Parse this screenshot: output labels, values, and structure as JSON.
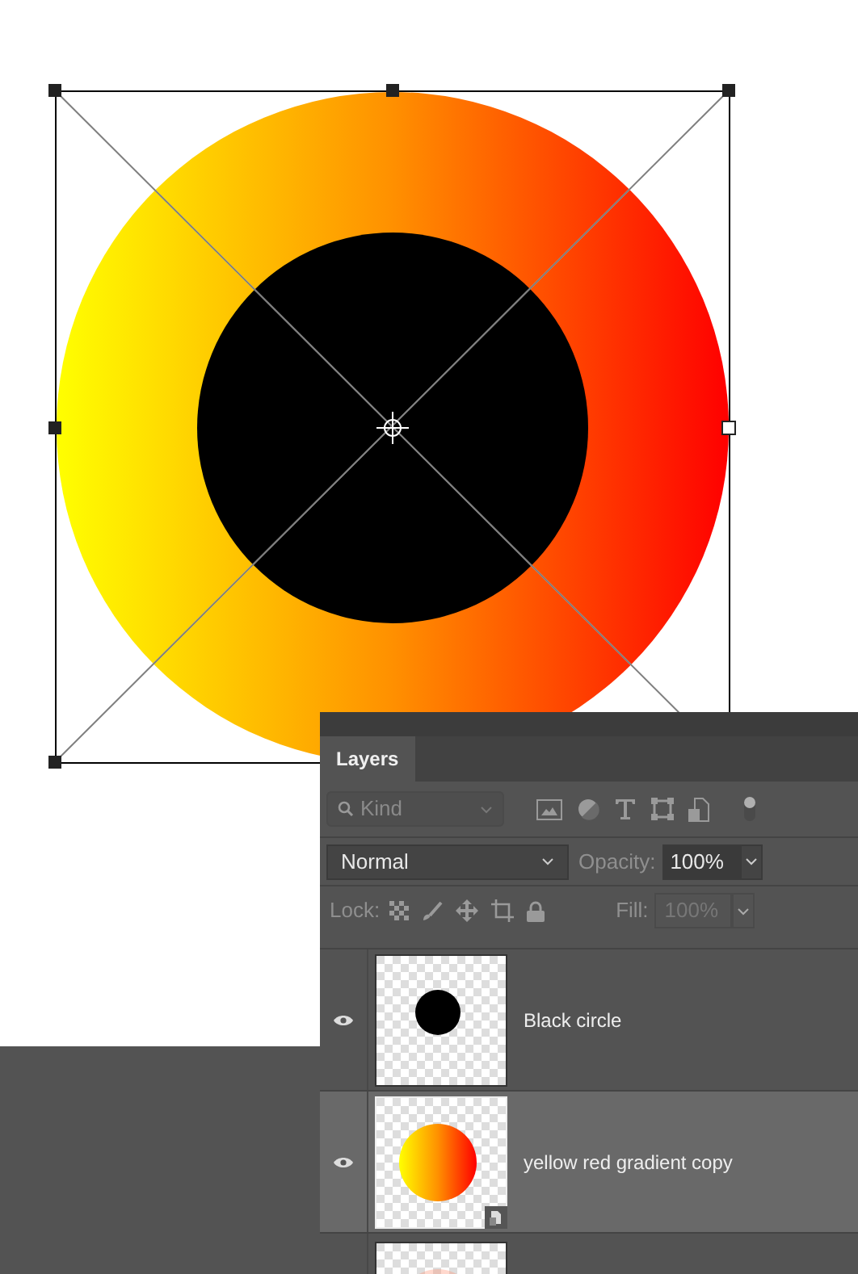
{
  "panel": {
    "tabs": [
      {
        "label": "Layers",
        "selected": true
      }
    ]
  },
  "filter": {
    "placeholder": "Kind"
  },
  "blend": {
    "mode": "Normal",
    "opacity_label": "Opacity:",
    "opacity": "100%"
  },
  "lock": {
    "label": "Lock:",
    "fill_label": "Fill:",
    "fill": "100%",
    "fill_disabled": true
  },
  "layers": [
    {
      "name": "Black circle",
      "kind": "dot",
      "visible": true,
      "selected": false,
      "smart_object": false
    },
    {
      "name": "yellow red gradient copy",
      "kind": "gradient",
      "visible": true,
      "selected": true,
      "smart_object": true
    },
    {
      "kind": "faded",
      "selected": false
    }
  ]
}
